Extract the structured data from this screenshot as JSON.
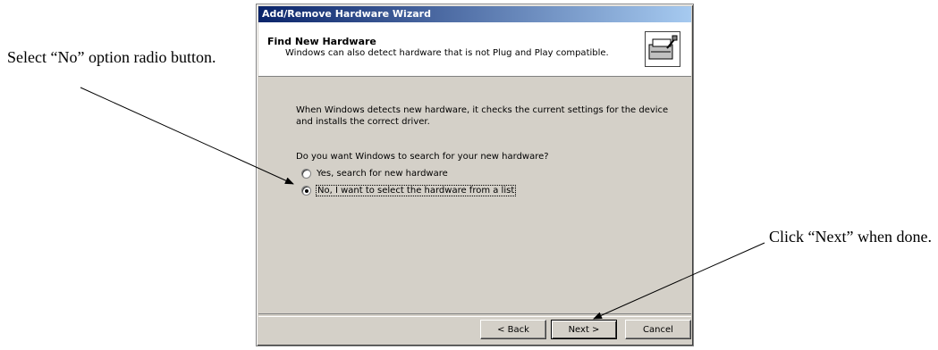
{
  "callouts": {
    "left": "Select “No” option radio button.",
    "right": "Click “Next” when done."
  },
  "dialog": {
    "title": "Add/Remove Hardware Wizard",
    "header_title": "Find New Hardware",
    "header_subtitle": "Windows can also detect hardware that is not Plug and Play compatible.",
    "header_icon": "hardware-wizard-icon",
    "description": "When Windows detects new hardware, it checks the current settings for the device and installs the correct driver.",
    "question": "Do you want Windows to search for your new hardware?",
    "options": [
      {
        "label": "Yes, search for new hardware",
        "selected": false
      },
      {
        "label": "No, I want to select the hardware from a list",
        "selected": true
      }
    ],
    "buttons": {
      "back": "< Back",
      "next": "Next >",
      "cancel": "Cancel"
    }
  }
}
